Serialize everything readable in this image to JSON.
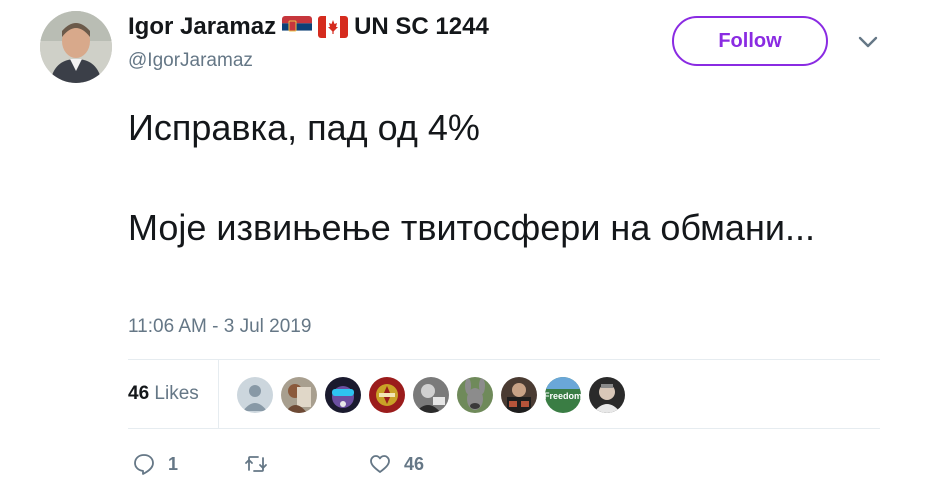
{
  "user": {
    "name": "Igor Jaramaz",
    "suffix": "UN SC 1244",
    "handle": "@IgorJaramaz"
  },
  "follow_label": "Follow",
  "tweet": {
    "line1": "Исправка, пад од 4%",
    "line2": "Моје извињење твитосфери на обмани..."
  },
  "timestamp": "11:06 AM - 3 Jul 2019",
  "likes": {
    "count": "46",
    "label": "Likes"
  },
  "favoriters": [
    "default-avatar",
    "avatar-2",
    "avatar-3",
    "avatar-4",
    "avatar-5",
    "avatar-6",
    "avatar-7",
    "avatar-8",
    "avatar-9"
  ],
  "freedom_badge": "Freedom",
  "actions": {
    "reply_count": "1",
    "retweet_count": "",
    "like_count": "46"
  },
  "colors": {
    "accent": "#8a2be2",
    "muted": "#657786",
    "text": "#14171a"
  }
}
